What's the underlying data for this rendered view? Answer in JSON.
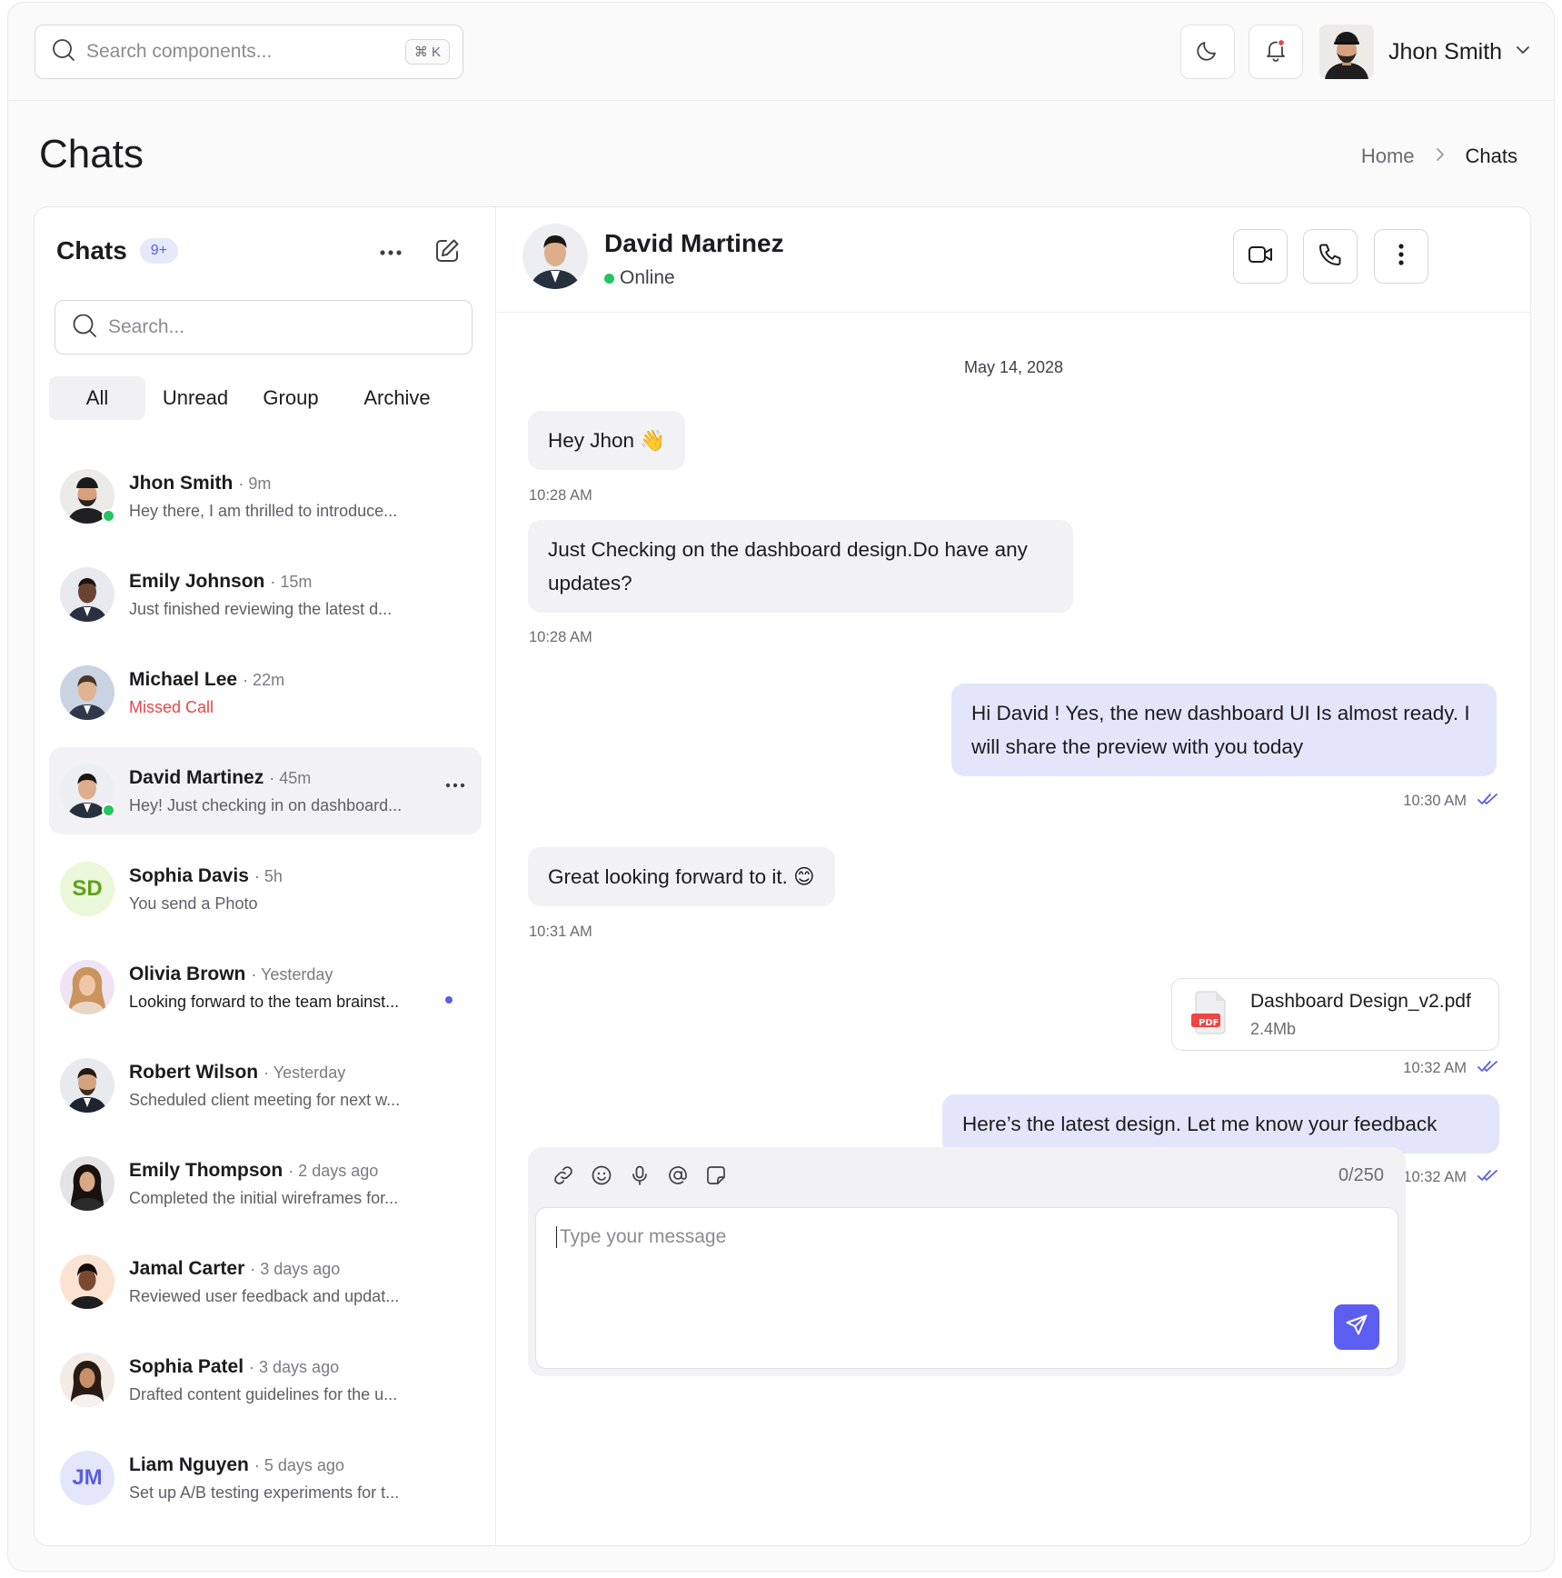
{
  "topbar": {
    "search_placeholder": "Search components...",
    "shortcut": "⌘ K",
    "theme_icon": "moon-icon",
    "notification_icon": "bell-icon",
    "user_name": "Jhon Smith"
  },
  "page": {
    "title": "Chats",
    "breadcrumb": {
      "home": "Home",
      "current": "Chats"
    }
  },
  "sidebar": {
    "title": "Chats",
    "badge": "9+",
    "search_placeholder": "Search...",
    "tabs": [
      {
        "label": "All",
        "active": true
      },
      {
        "label": "Unread",
        "active": false
      },
      {
        "label": "Group",
        "active": false
      },
      {
        "label": "Archive",
        "active": false
      }
    ],
    "chats": [
      {
        "name": "Jhon Smith",
        "time": "· 9m",
        "preview": "Hey there, I am thrilled to introduce...",
        "online": true
      },
      {
        "name": "Emily Johnson",
        "time": "· 15m",
        "preview": "Just finished reviewing the latest d...",
        "online": false
      },
      {
        "name": "Michael Lee",
        "time": "· 22m",
        "preview": "Missed Call",
        "missed": true
      },
      {
        "name": "David Martinez",
        "time": "· 45m",
        "preview": "Hey! Just checking in on dashboard...",
        "online": true,
        "selected": true
      },
      {
        "name": "Sophia Davis",
        "time": "· 5h",
        "preview": "You send a Photo",
        "initials": "SD"
      },
      {
        "name": "Olivia Brown",
        "time": "· Yesterday",
        "preview": "Looking forward to the team brainst...",
        "unread": true
      },
      {
        "name": "Robert Wilson",
        "time": "· Yesterday",
        "preview": "Scheduled client meeting for next w..."
      },
      {
        "name": "Emily Thompson",
        "time": "· 2 days ago",
        "preview": "Completed the initial wireframes for..."
      },
      {
        "name": "Jamal Carter",
        "time": "· 3 days ago",
        "preview": "Reviewed user feedback and updat..."
      },
      {
        "name": "Sophia Patel",
        "time": "· 3 days ago",
        "preview": "Drafted content guidelines for the u..."
      },
      {
        "name": "Liam Nguyen",
        "time": "· 5 days ago",
        "preview": "Set up A/B testing experiments for t...",
        "initials": "JM"
      }
    ]
  },
  "conversation": {
    "name": "David Martinez",
    "status": "Online",
    "date": "May 14, 2028",
    "messages": [
      {
        "text": "Hey Jhon 👋",
        "time": "10:28 AM",
        "direction": "in"
      },
      {
        "text": "Just Checking on the dashboard design.Do have any updates?",
        "time": "10:28 AM",
        "direction": "in"
      },
      {
        "text": "Hi David ! Yes, the new dashboard UI Is almost ready. I will share the preview with you today",
        "time": "10:30 AM",
        "direction": "out"
      },
      {
        "text": "Great looking forward to it. 😊",
        "time": "10:31 AM",
        "direction": "in"
      },
      {
        "file_name": "Dashboard Design_v2.pdf",
        "file_size": "2.4Mb",
        "file_type": "PDF",
        "time": "10:32 AM",
        "direction": "out"
      },
      {
        "text": "Here’s the latest design. Let me know your feedback",
        "time": "10:32 AM",
        "direction": "out"
      }
    ]
  },
  "composer": {
    "placeholder": "Type your message",
    "counter": "0/250",
    "tools": [
      "link-icon",
      "emoji-icon",
      "microphone-icon",
      "mention-icon",
      "sticker-icon"
    ]
  },
  "colors": {
    "accent": "#5b5ef0",
    "online": "#22c55e",
    "missed": "#e5484d",
    "outgoing_bubble": "#e3e6fb"
  }
}
